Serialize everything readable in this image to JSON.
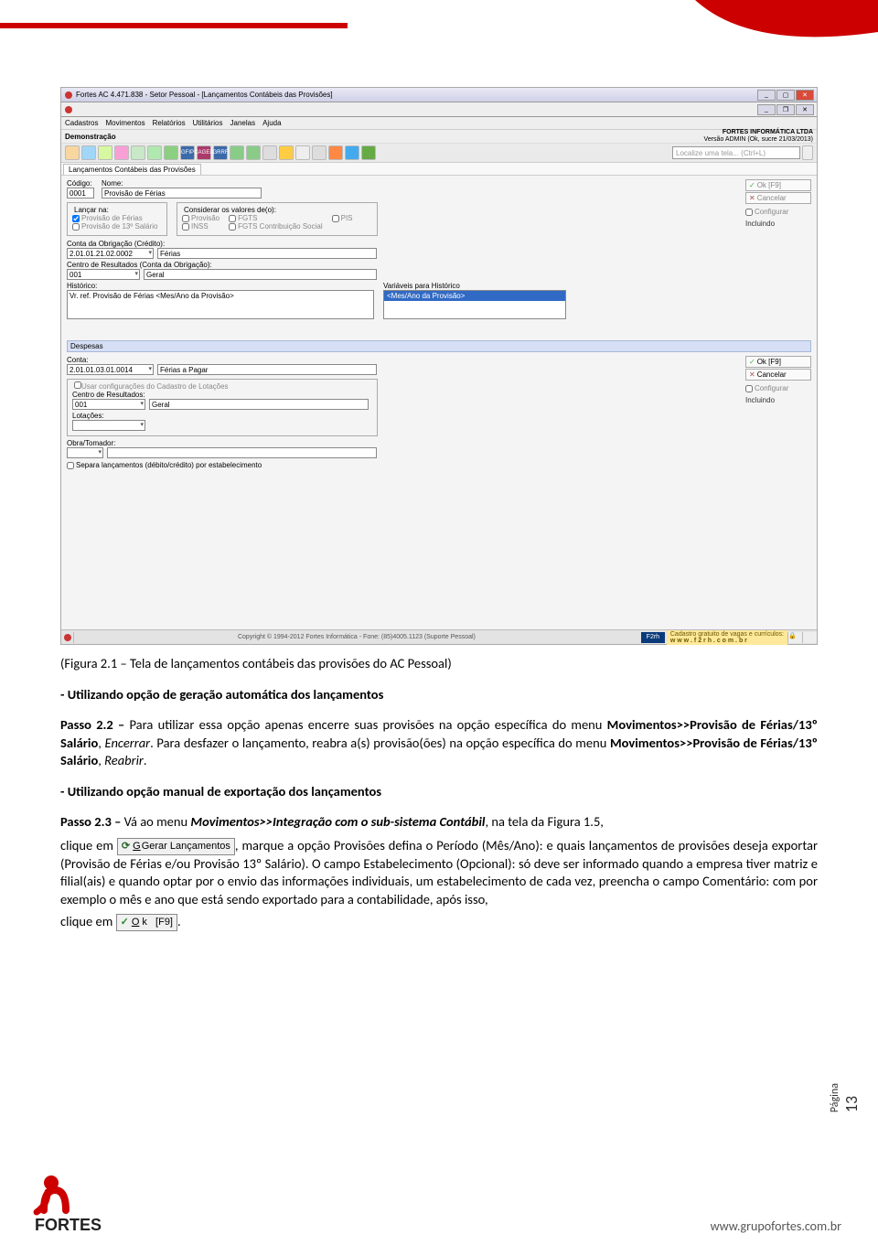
{
  "header": {
    "accent_color": "#c00"
  },
  "screenshot": {
    "title": "Fortes AC 4.471.838 - Setor Pessoal - [Lançamentos Contábeis das Provisões]",
    "menubar": [
      "Cadastros",
      "Movimentos",
      "Relatórios",
      "Utilitários",
      "Janelas",
      "Ajuda"
    ],
    "demo_label": "Demonstração",
    "company": "FORTES INFORMÁTICA LTDA",
    "company_sub": "Versão ADMIN (Ok, sucre 21/03/2013)",
    "search_placeholder": "Localize uma tela... (Ctrl+L)",
    "tab": "Lançamentos Contábeis das Provisões",
    "codigo_label": "Código:",
    "codigo_value": "0001",
    "nome_label": "Nome:",
    "nome_value": "Provisão de Férias",
    "lancar_na": "Lançar na:",
    "considerar": "Considerar os valores de(o):",
    "chk_prov_ferias": "Provisão de Férias",
    "chk_prov_13": "Provisão de 13º Salário",
    "chk_provisao": "Provisão",
    "chk_inss": "INSS",
    "chk_fgts": "FGTS",
    "chk_fgts_cs": "FGTS Contribuição Social",
    "chk_pis": "PIS",
    "conta_obrig_label": "Conta da Obrigação (Crédito):",
    "conta_obrig_code": "2.01.01.21.02.0002",
    "conta_obrig_name": "Férias",
    "centro_res_obrig_label": "Centro de Resultados (Conta da Obrigação):",
    "centro_code": "001",
    "centro_name": "Geral",
    "historico_label": "Histórico:",
    "historico_value": "Vr. ref. Provisão de Férias <Mes/Ano da Provisão>",
    "var_label": "Variáveis para Histórico",
    "var_selected": "<Mes/Ano da Provisão>",
    "despesas_hdr": "Despesas",
    "conta_label": "Conta:",
    "conta_code": "2.01.01.03.01.0014",
    "conta_name": "Férias a Pagar",
    "usar_conf": "Usar configurações do Cadastro de Lotações",
    "centro_res_label": "Centro de Resultados:",
    "lotacoes_label": "Lotações:",
    "obra_label": "Obra/Tomador:",
    "separa_lanc": "Separa lançamentos (débito/crédito) por estabelecimento",
    "btn_ok": "Ok     [F9]",
    "btn_cancel": "Cancelar",
    "btn_config": "Configurar",
    "status_incluindo": "Incluindo",
    "copyright": "Copyright © 1994-2012  Fortes Informática - Fone: (85)4005.1123 (Suporte Pessoal)",
    "f2rh": "F2rh",
    "ad_line1": "Cadastro gratuito de vagas e currículos:",
    "ad_line2": "w w w . f 2 r h . c o m . b r"
  },
  "text": {
    "caption": "(Figura 2.1 – Tela de lançamentos contábeis das provisões do AC Pessoal)",
    "sub1": "- Utilizando opção de geração automática dos lançamentos",
    "passo22_lead": "Passo 2.2 –",
    "passo22_body1": " Para utilizar essa opção apenas encerre suas provisões na opção específica do menu ",
    "passo22_bold1": "Movimentos>>Provisão de Férias/13º Salário",
    "passo22_body2": ", ",
    "passo22_ital1": "Encerrar",
    "passo22_body3": ". Para desfazer o lançamento, reabra a(s) provisão(ões) na opção específica do menu ",
    "passo22_bold2": "Movimentos>>Provisão de Férias/13º Salário",
    "passo22_body4": ", ",
    "passo22_ital2": "Reabrir",
    "passo22_body5": ".",
    "sub2": "- Utilizando opção manual de exportação dos lançamentos",
    "passo23_lead": "Passo 2.3 –",
    "passo23_body1": " Vá ao menu ",
    "passo23_bolditalic": "Movimentos>>Integração com o sub-sistema Contábil",
    "passo23_body2": ", na tela da Figura 1.5,",
    "passo23_body3": "clique em ",
    "gerar_btn": "Gerar Lançamentos",
    "passo23_body4": ", marque a opção Provisões defina o Período (Mês/Ano): e quais lançamentos de provisões deseja exportar (Provisão de Férias e/ou Provisão 13º Salário). O campo Estabelecimento (Opcional): só deve ser informado quando a empresa tiver matriz e filial(ais) e quando optar por o envio das informações individuais, um estabelecimento de cada vez, preencha o campo Comentário: com por exemplo o mês e ano que está sendo exportado para a contabilidade, após isso,",
    "passo23_body5": "clique em ",
    "ok_btn": "Ok     [F9]",
    "passo23_body6": "."
  },
  "footer": {
    "page_label": "Página",
    "page_number": "13",
    "url": "www.grupofortes.com.br",
    "logo_text": "FORTES"
  }
}
